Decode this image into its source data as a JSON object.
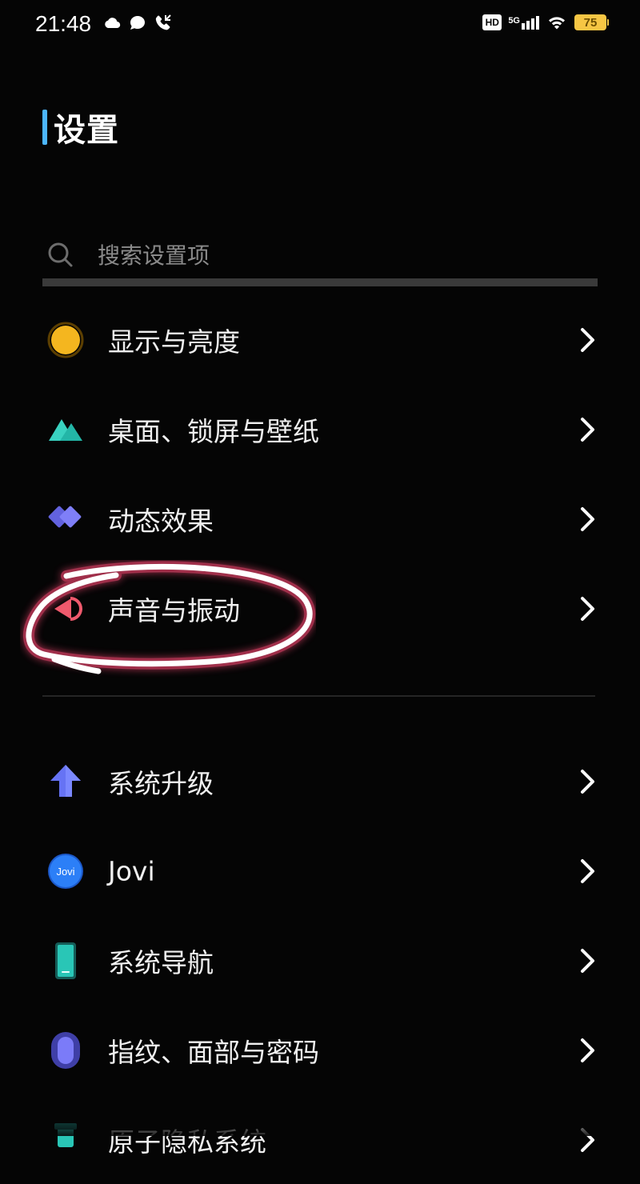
{
  "status_bar": {
    "time": "21:48",
    "left_icons": [
      "cloud-icon",
      "message-icon",
      "missed-call-icon"
    ],
    "right_icons": [
      "hd-badge",
      "5g-signal-icon",
      "wifi-icon",
      "battery-icon"
    ],
    "hd_label": "HD",
    "network_label": "5G",
    "battery_percent": "75",
    "battery_color": "#f6c644"
  },
  "page": {
    "title": "设置",
    "title_accent_color": "#4cb6ff"
  },
  "search": {
    "placeholder": "搜索设置项",
    "value": ""
  },
  "settings": {
    "items": [
      {
        "label": "显示与亮度",
        "icon": "display-brightness-icon",
        "color": "#f4b61f"
      },
      {
        "label": "桌面、锁屏与壁纸",
        "icon": "wallpaper-icon",
        "color": "#39d2c0"
      },
      {
        "label": "动态效果",
        "icon": "motion-effects-icon",
        "color": "#6c6cf2"
      },
      {
        "label": "声音与振动",
        "icon": "sound-vibration-icon",
        "color": "#ef5a6d",
        "annotated": true
      },
      {
        "label": "系统升级",
        "icon": "system-update-icon",
        "color": "#6673f4"
      },
      {
        "label": "Jovi",
        "icon": "jovi-icon",
        "color": "#2f86ff"
      },
      {
        "label": "系统导航",
        "icon": "system-navigation-icon",
        "color": "#29c6b6"
      },
      {
        "label": "指纹、面部与密码",
        "icon": "fingerprint-face-password-icon",
        "color": "#6262df"
      },
      {
        "label": "原子隐私系统",
        "icon": "privacy-system-icon",
        "color": "#29c6b6"
      }
    ]
  },
  "jovi_icon_text": "Jovi",
  "annotation": {
    "shape": "hand-drawn-circle",
    "color": "#ffffff",
    "glow_color": "#d43e62"
  }
}
